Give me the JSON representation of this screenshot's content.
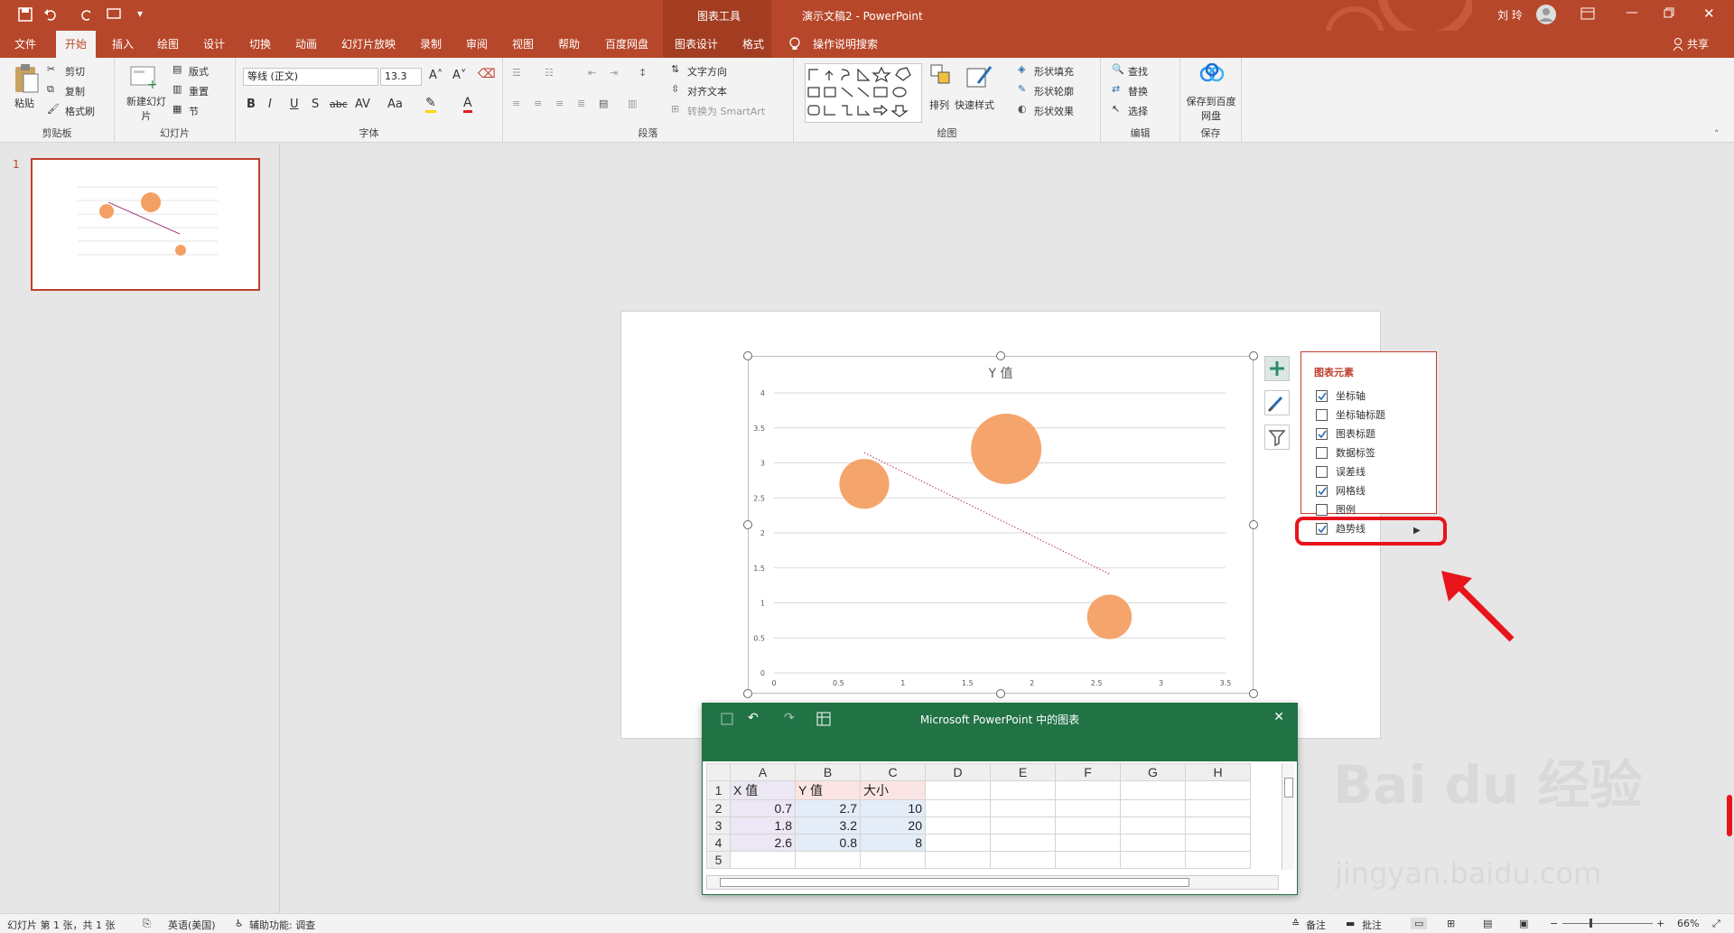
{
  "title_bar": {
    "chart_tools": "图表工具",
    "doc_title": "演示文稿2 - PowerPoint",
    "user": "刘 玲",
    "share": "共享"
  },
  "tabs": [
    "文件",
    "开始",
    "插入",
    "绘图",
    "设计",
    "切换",
    "动画",
    "幻灯片放映",
    "录制",
    "审阅",
    "视图",
    "帮助",
    "百度网盘",
    "图表设计",
    "格式",
    "操作说明搜索"
  ],
  "ribbon": {
    "clipboard": {
      "paste": "粘贴",
      "cut": "剪切",
      "copy": "复制",
      "format_painter": "格式刷",
      "label": "剪贴板"
    },
    "slides": {
      "new_slide": "新建幻灯片",
      "layout": "版式",
      "reset": "重置",
      "section": "节",
      "label": "幻灯片"
    },
    "font": {
      "name": "等线 (正文)",
      "size": "13.3",
      "label": "字体"
    },
    "paragraph": {
      "text_direction": "文字方向",
      "align_text": "对齐文本",
      "smartart": "转换为 SmartArt",
      "label": "段落"
    },
    "drawing": {
      "arrange": "排列",
      "quick_styles": "快速样式",
      "fill": "形状填充",
      "outline": "形状轮廓",
      "effects": "形状效果",
      "label": "绘图"
    },
    "editing": {
      "find": "查找",
      "replace": "替换",
      "select": "选择",
      "label": "编辑"
    },
    "save": {
      "save_cloud": "保存到百度网盘",
      "label": "保存"
    }
  },
  "slide_number": "1",
  "chart_elements": {
    "header": "图表元素",
    "items": [
      {
        "label": "坐标轴",
        "checked": true
      },
      {
        "label": "坐标轴标题",
        "checked": false
      },
      {
        "label": "图表标题",
        "checked": true
      },
      {
        "label": "数据标签",
        "checked": false
      },
      {
        "label": "误差线",
        "checked": false
      },
      {
        "label": "网格线",
        "checked": true
      },
      {
        "label": "图例",
        "checked": false
      },
      {
        "label": "趋势线",
        "checked": true
      }
    ]
  },
  "chart_data": {
    "type": "scatter",
    "subtype": "bubble",
    "title": "Y 值",
    "xlim": [
      0,
      3.5
    ],
    "ylim": [
      0,
      4
    ],
    "x_ticks": [
      "0",
      "0.5",
      "1",
      "1.5",
      "2",
      "2.5",
      "3",
      "3.5"
    ],
    "y_ticks": [
      "0",
      "0.5",
      "1",
      "1.5",
      "2",
      "2.5",
      "3",
      "3.5",
      "4"
    ],
    "points": [
      {
        "x": 0.7,
        "y": 2.7,
        "size": 10
      },
      {
        "x": 1.8,
        "y": 3.2,
        "size": 20
      },
      {
        "x": 2.6,
        "y": 0.8,
        "size": 8
      }
    ],
    "trendline": {
      "type": "linear",
      "style": "dotted"
    },
    "grid": true,
    "legend": false,
    "color": "#f4a064"
  },
  "excel": {
    "title": "Microsoft PowerPoint 中的图表",
    "columns": [
      "A",
      "B",
      "C",
      "D",
      "E",
      "F",
      "G",
      "H"
    ],
    "rows": [
      [
        "X 值",
        "Y 值",
        "大小"
      ],
      [
        "0.7",
        "2.7",
        "10"
      ],
      [
        "1.8",
        "3.2",
        "20"
      ],
      [
        "2.6",
        "0.8",
        "8"
      ],
      [
        "",
        "",
        ""
      ]
    ]
  },
  "status": {
    "slide_info": "幻灯片 第 1 张，共 1 张",
    "language": "英语(美国)",
    "accessibility": "辅助功能: 调查",
    "notes": "备注",
    "comments": "批注",
    "zoom": "66%"
  },
  "watermark": {
    "brand": "Bai du 经验",
    "url": "jingyan.baidu.com"
  }
}
